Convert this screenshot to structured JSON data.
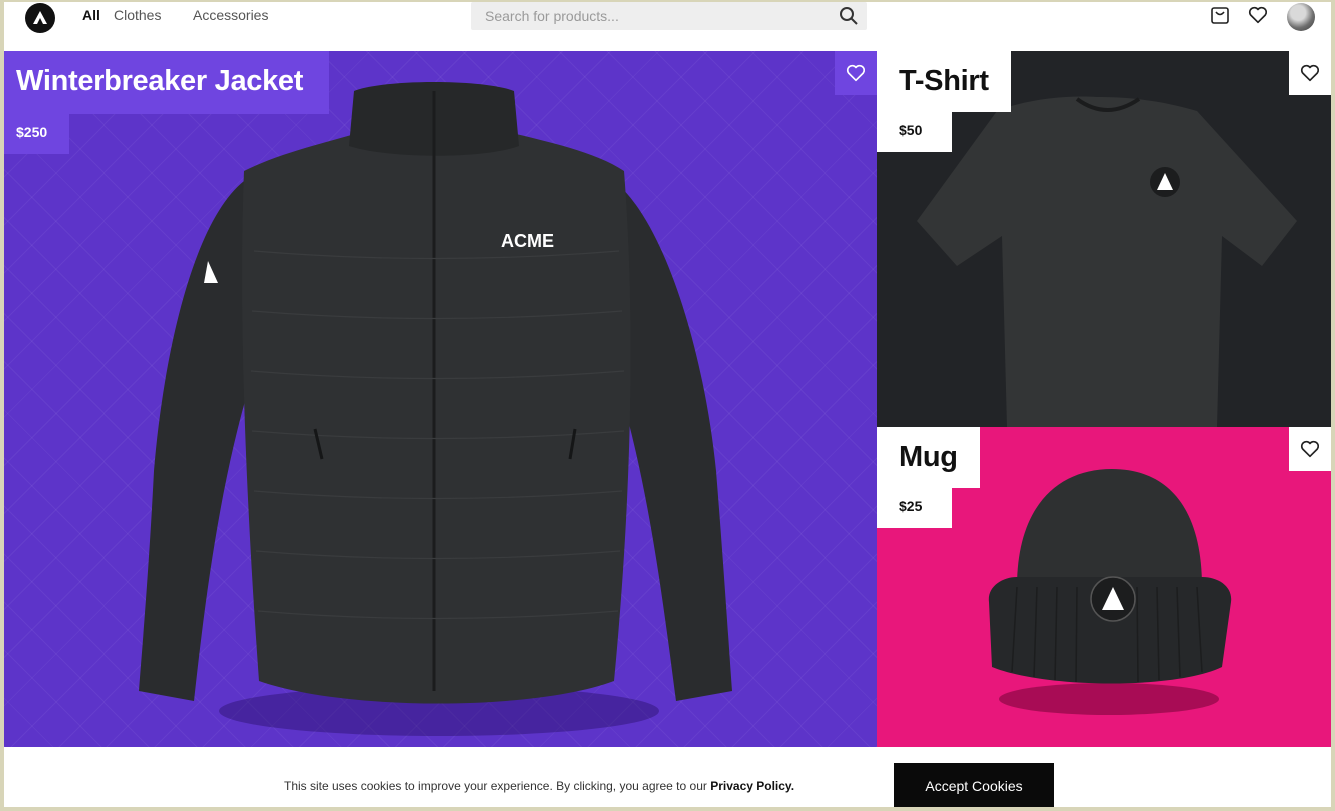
{
  "nav": {
    "links": [
      {
        "label": "All",
        "active": true
      },
      {
        "label": "Clothes",
        "active": false
      },
      {
        "label": "Accessories",
        "active": false
      }
    ],
    "search_placeholder": "Search for products...",
    "icons": [
      "logo-icon",
      "search-icon",
      "cart-icon",
      "heart-icon",
      "avatar"
    ]
  },
  "products": [
    {
      "name": "Winterbreaker Jacket",
      "price": "$250",
      "background": "#5d34c9"
    },
    {
      "name": "T-Shirt",
      "price": "$50",
      "background": "#222427"
    },
    {
      "name": "Mug",
      "price": "$25",
      "background": "#e8177b"
    }
  ],
  "product_image_text": {
    "jacket_brand": "ACME"
  },
  "cookie": {
    "message": "This site uses cookies to improve your experience. By clicking, you agree to our",
    "policy_link": "Privacy Policy.",
    "accept_label": "Accept Cookies"
  }
}
